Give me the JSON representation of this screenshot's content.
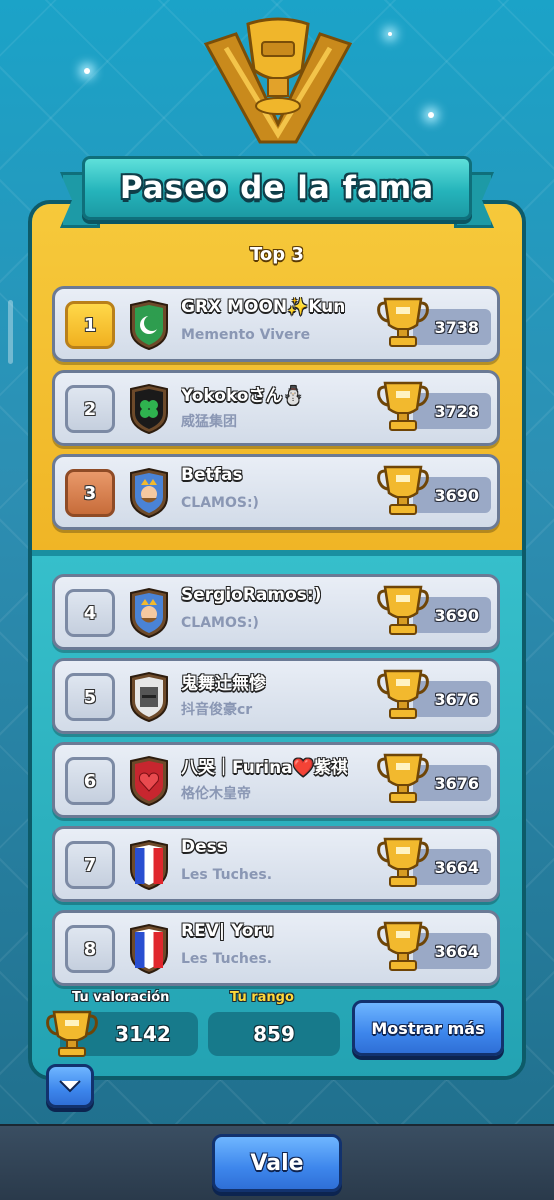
{
  "title": "Paseo de la fama",
  "top3_label": "Top 3",
  "colors": {
    "gold_panel": "#f2bb2c",
    "teal_panel": "#2fb3c1",
    "button_blue": "#3d86ec",
    "highlight_yellow": "#ffd93b"
  },
  "rows": [
    {
      "rank": "1",
      "rank_style": "gold",
      "name": "GRX MOON✨Kun",
      "clan": "Memento Vivere",
      "trophies": "3738",
      "badge": "crescent-badge-icon"
    },
    {
      "rank": "2",
      "rank_style": "silver",
      "name": "Yokokoさん⛄",
      "clan": "威猛集团",
      "trophies": "3728",
      "badge": "clover-badge-icon"
    },
    {
      "rank": "3",
      "rank_style": "bronze",
      "name": "Betfas",
      "clan": "CLAMOS:)",
      "trophies": "3690",
      "badge": "king-badge-icon"
    },
    {
      "rank": "4",
      "rank_style": "plain",
      "name": "SergioRamos:)",
      "clan": "CLAMOS:)",
      "trophies": "3690",
      "badge": "king-badge-icon"
    },
    {
      "rank": "5",
      "rank_style": "plain",
      "name": "鬼舞辻無惨",
      "clan": "抖音俊豪cr",
      "trophies": "3676",
      "badge": "knight-helmet-badge-icon"
    },
    {
      "rank": "6",
      "rank_style": "plain",
      "name": "八哭｜Furina❤️紫祺",
      "clan": "格伦木皇帝",
      "trophies": "3676",
      "badge": "heart-badge-icon"
    },
    {
      "rank": "7",
      "rank_style": "plain",
      "name": "Dess",
      "clan": "Les Tuches.",
      "trophies": "3664",
      "badge": "french-flag-badge-icon"
    },
    {
      "rank": "8",
      "rank_style": "plain",
      "name": "REV|  Yoru",
      "clan": "Les Tuches.",
      "trophies": "3664",
      "badge": "french-flag-badge-icon"
    }
  ],
  "footer": {
    "rating_label": "Tu valoración",
    "rating_value": "3142",
    "rank_label": "Tu rango",
    "rank_value": "859",
    "show_more": "Mostrar más"
  },
  "ok_button": "Vale"
}
